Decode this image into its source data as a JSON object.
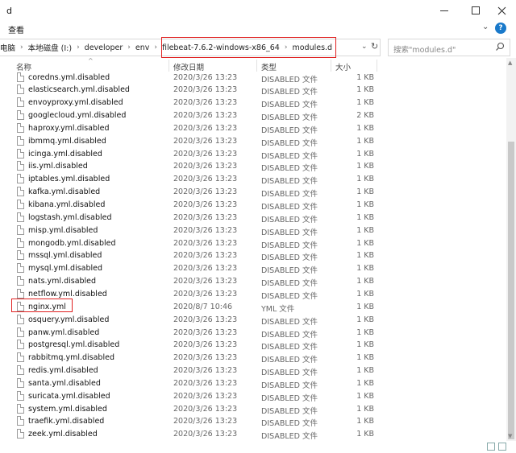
{
  "window": {
    "title": "d"
  },
  "ribbon": {
    "tab_view": "查看",
    "help": "?"
  },
  "address": {
    "crumbs": [
      "电脑",
      "本地磁盘 (I:)",
      "developer",
      "env",
      "filebeat-7.6.2-windows-x86_64",
      "modules.d"
    ]
  },
  "search": {
    "placeholder": "搜索\"modules.d\""
  },
  "columns": {
    "name": "名称",
    "date": "修改日期",
    "type": "类型",
    "size": "大小"
  },
  "files": [
    {
      "name": "coredns.yml.disabled",
      "date": "2020/3/26 13:23",
      "type": "DISABLED 文件",
      "size": "1 KB"
    },
    {
      "name": "elasticsearch.yml.disabled",
      "date": "2020/3/26 13:23",
      "type": "DISABLED 文件",
      "size": "1 KB"
    },
    {
      "name": "envoyproxy.yml.disabled",
      "date": "2020/3/26 13:23",
      "type": "DISABLED 文件",
      "size": "1 KB"
    },
    {
      "name": "googlecloud.yml.disabled",
      "date": "2020/3/26 13:23",
      "type": "DISABLED 文件",
      "size": "2 KB"
    },
    {
      "name": "haproxy.yml.disabled",
      "date": "2020/3/26 13:23",
      "type": "DISABLED 文件",
      "size": "1 KB"
    },
    {
      "name": "ibmmq.yml.disabled",
      "date": "2020/3/26 13:23",
      "type": "DISABLED 文件",
      "size": "1 KB"
    },
    {
      "name": "icinga.yml.disabled",
      "date": "2020/3/26 13:23",
      "type": "DISABLED 文件",
      "size": "1 KB"
    },
    {
      "name": "iis.yml.disabled",
      "date": "2020/3/26 13:23",
      "type": "DISABLED 文件",
      "size": "1 KB"
    },
    {
      "name": "iptables.yml.disabled",
      "date": "2020/3/26 13:23",
      "type": "DISABLED 文件",
      "size": "1 KB"
    },
    {
      "name": "kafka.yml.disabled",
      "date": "2020/3/26 13:23",
      "type": "DISABLED 文件",
      "size": "1 KB"
    },
    {
      "name": "kibana.yml.disabled",
      "date": "2020/3/26 13:23",
      "type": "DISABLED 文件",
      "size": "1 KB"
    },
    {
      "name": "logstash.yml.disabled",
      "date": "2020/3/26 13:23",
      "type": "DISABLED 文件",
      "size": "1 KB"
    },
    {
      "name": "misp.yml.disabled",
      "date": "2020/3/26 13:23",
      "type": "DISABLED 文件",
      "size": "1 KB"
    },
    {
      "name": "mongodb.yml.disabled",
      "date": "2020/3/26 13:23",
      "type": "DISABLED 文件",
      "size": "1 KB"
    },
    {
      "name": "mssql.yml.disabled",
      "date": "2020/3/26 13:23",
      "type": "DISABLED 文件",
      "size": "1 KB"
    },
    {
      "name": "mysql.yml.disabled",
      "date": "2020/3/26 13:23",
      "type": "DISABLED 文件",
      "size": "1 KB"
    },
    {
      "name": "nats.yml.disabled",
      "date": "2020/3/26 13:23",
      "type": "DISABLED 文件",
      "size": "1 KB"
    },
    {
      "name": "netflow.yml.disabled",
      "date": "2020/3/26 13:23",
      "type": "DISABLED 文件",
      "size": "1 KB"
    },
    {
      "name": "nginx.yml",
      "date": "2020/8/7 10:46",
      "type": "YML 文件",
      "size": "1 KB"
    },
    {
      "name": "osquery.yml.disabled",
      "date": "2020/3/26 13:23",
      "type": "DISABLED 文件",
      "size": "1 KB"
    },
    {
      "name": "panw.yml.disabled",
      "date": "2020/3/26 13:23",
      "type": "DISABLED 文件",
      "size": "1 KB"
    },
    {
      "name": "postgresql.yml.disabled",
      "date": "2020/3/26 13:23",
      "type": "DISABLED 文件",
      "size": "1 KB"
    },
    {
      "name": "rabbitmq.yml.disabled",
      "date": "2020/3/26 13:23",
      "type": "DISABLED 文件",
      "size": "1 KB"
    },
    {
      "name": "redis.yml.disabled",
      "date": "2020/3/26 13:23",
      "type": "DISABLED 文件",
      "size": "1 KB"
    },
    {
      "name": "santa.yml.disabled",
      "date": "2020/3/26 13:23",
      "type": "DISABLED 文件",
      "size": "1 KB"
    },
    {
      "name": "suricata.yml.disabled",
      "date": "2020/3/26 13:23",
      "type": "DISABLED 文件",
      "size": "1 KB"
    },
    {
      "name": "system.yml.disabled",
      "date": "2020/3/26 13:23",
      "type": "DISABLED 文件",
      "size": "1 KB"
    },
    {
      "name": "traefik.yml.disabled",
      "date": "2020/3/26 13:23",
      "type": "DISABLED 文件",
      "size": "1 KB"
    },
    {
      "name": "zeek.yml.disabled",
      "date": "2020/3/26 13:23",
      "type": "DISABLED 文件",
      "size": "1 KB"
    }
  ],
  "colors": {
    "highlight": "#e02020",
    "help_accent": "#1979ca"
  },
  "icons": [
    "minimize-icon",
    "maximize-icon",
    "close-icon",
    "help-icon",
    "refresh-icon",
    "search-icon",
    "file-icon"
  ]
}
